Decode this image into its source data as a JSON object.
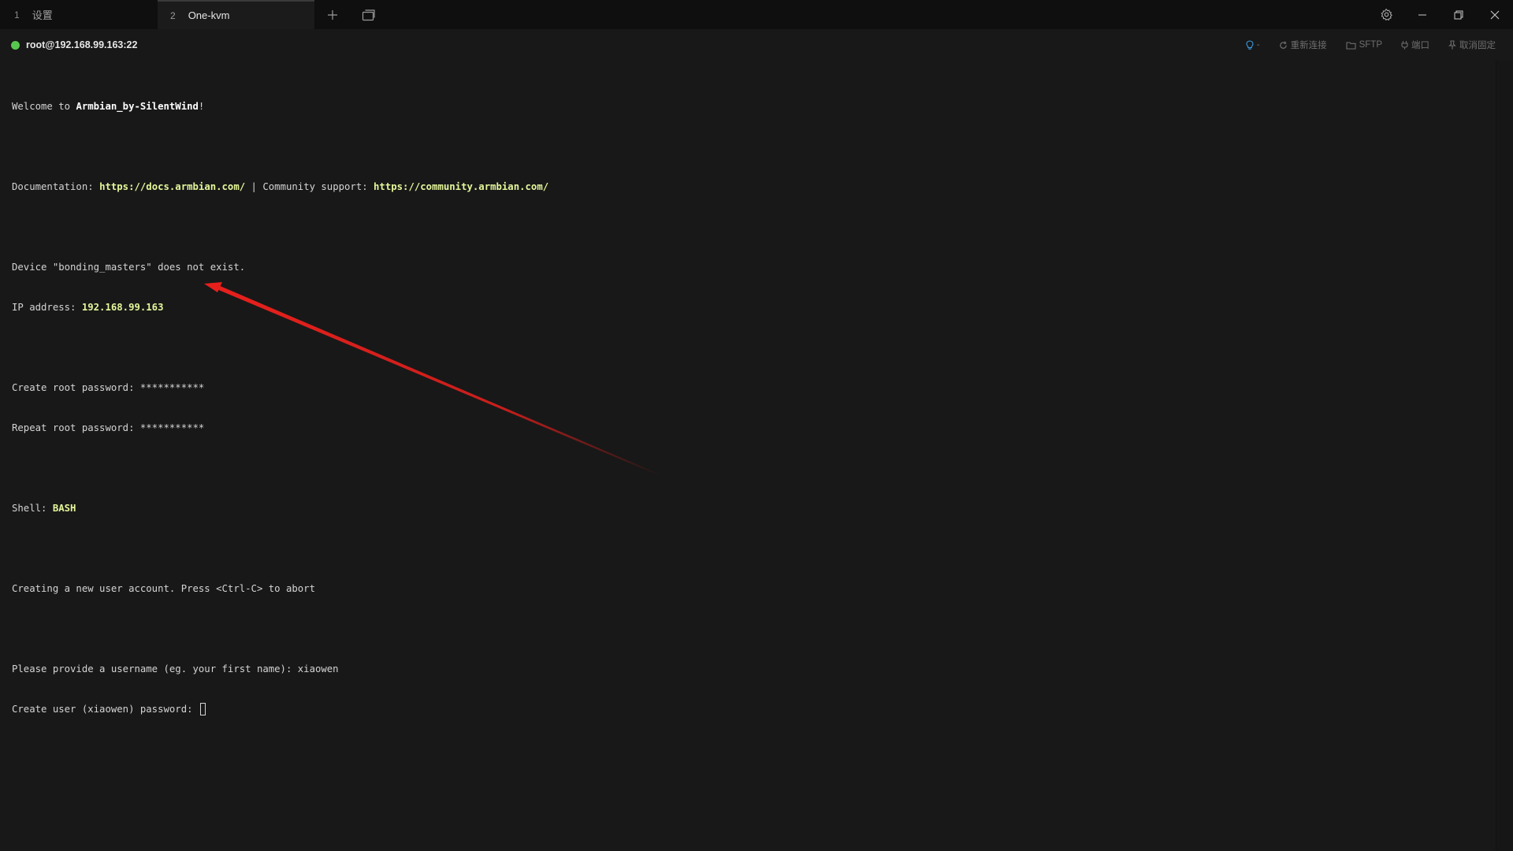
{
  "tabs": [
    {
      "number": "1",
      "label": "设置",
      "active": false
    },
    {
      "number": "2",
      "label": "One-kvm",
      "active": true
    }
  ],
  "titlebar_icons": {
    "new_tab": "plus-icon",
    "window_list": "windows-icon",
    "settings": "gear-icon",
    "minimize": "minimize-icon",
    "restore": "restore-icon",
    "close": "close-icon"
  },
  "session": {
    "host": "root@192.168.99.163:22",
    "status_color": "#57c84d",
    "actions": {
      "bulb_dropdown": "-",
      "reconnect": "重新连接",
      "sftp": "SFTP",
      "port": "端口",
      "unpin": "取消固定"
    }
  },
  "terminal": {
    "welcome_prefix": "Welcome to ",
    "welcome_name": "Armbian_by-SilentWind",
    "welcome_suffix": "!",
    "doc_label": "Documentation: ",
    "doc_url": "https://docs.armbian.com/",
    "doc_sep": " | Community support: ",
    "community_url": "https://community.armbian.com/",
    "device_line": "Device \"bonding_masters\" does not exist.",
    "ip_label": "IP address: ",
    "ip_value": "192.168.99.163",
    "create_root": "Create root password: ***********",
    "repeat_root": "Repeat root password: ***********",
    "shell_label": "Shell: ",
    "shell_value": "BASH",
    "creating_user": "Creating a new user account. Press <Ctrl-C> to abort",
    "username_prompt": "Please provide a username (eg. your first name): xiaowen",
    "user_password_prompt": "Create user (xiaowen) password: "
  },
  "colors": {
    "highlight": "#e4f79a",
    "annotation_arrow": "#e8201c"
  }
}
